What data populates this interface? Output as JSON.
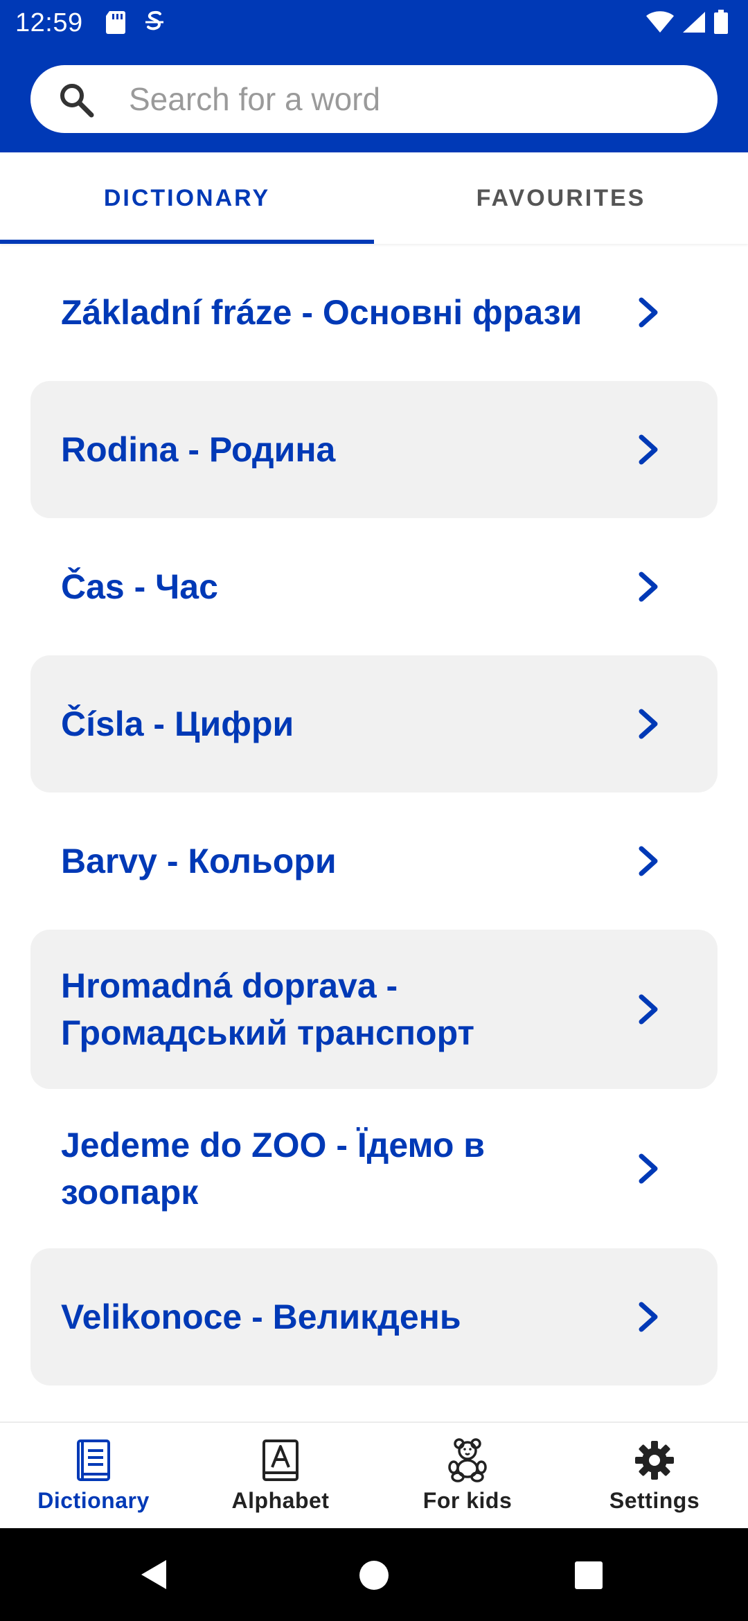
{
  "status_bar": {
    "time": "12:59",
    "left_icons": [
      "sd-card-icon",
      "vpn-key-icon"
    ],
    "right_icons": [
      "wifi-icon",
      "signal-icon",
      "battery-icon"
    ]
  },
  "search": {
    "placeholder": "Search for a word",
    "value": ""
  },
  "tabs": [
    {
      "label": "DICTIONARY",
      "active": true
    },
    {
      "label": "FAVOURITES",
      "active": false
    }
  ],
  "categories": [
    {
      "label": "Základní fráze - Основні фрази"
    },
    {
      "label": "Rodina - Родина"
    },
    {
      "label": "Čas - Час"
    },
    {
      "label": "Čísla - Цифри"
    },
    {
      "label": "Barvy - Кольори"
    },
    {
      "label": "Hromadná doprava - Громадський транспорт"
    },
    {
      "label": "Jedeme do ZOO - Їдемо в зоопарк"
    },
    {
      "label": "Velikonoce - Великдень"
    }
  ],
  "bottom_nav": [
    {
      "label": "Dictionary",
      "icon": "book-icon",
      "active": true
    },
    {
      "label": "Alphabet",
      "icon": "alphabet-icon",
      "active": false
    },
    {
      "label": "For kids",
      "icon": "teddy-bear-icon",
      "active": false
    },
    {
      "label": "Settings",
      "icon": "gear-icon",
      "active": false
    }
  ],
  "colors": {
    "primary": "#0039b6",
    "shaded_row": "#f1f1f1",
    "inactive_text": "#555555"
  }
}
